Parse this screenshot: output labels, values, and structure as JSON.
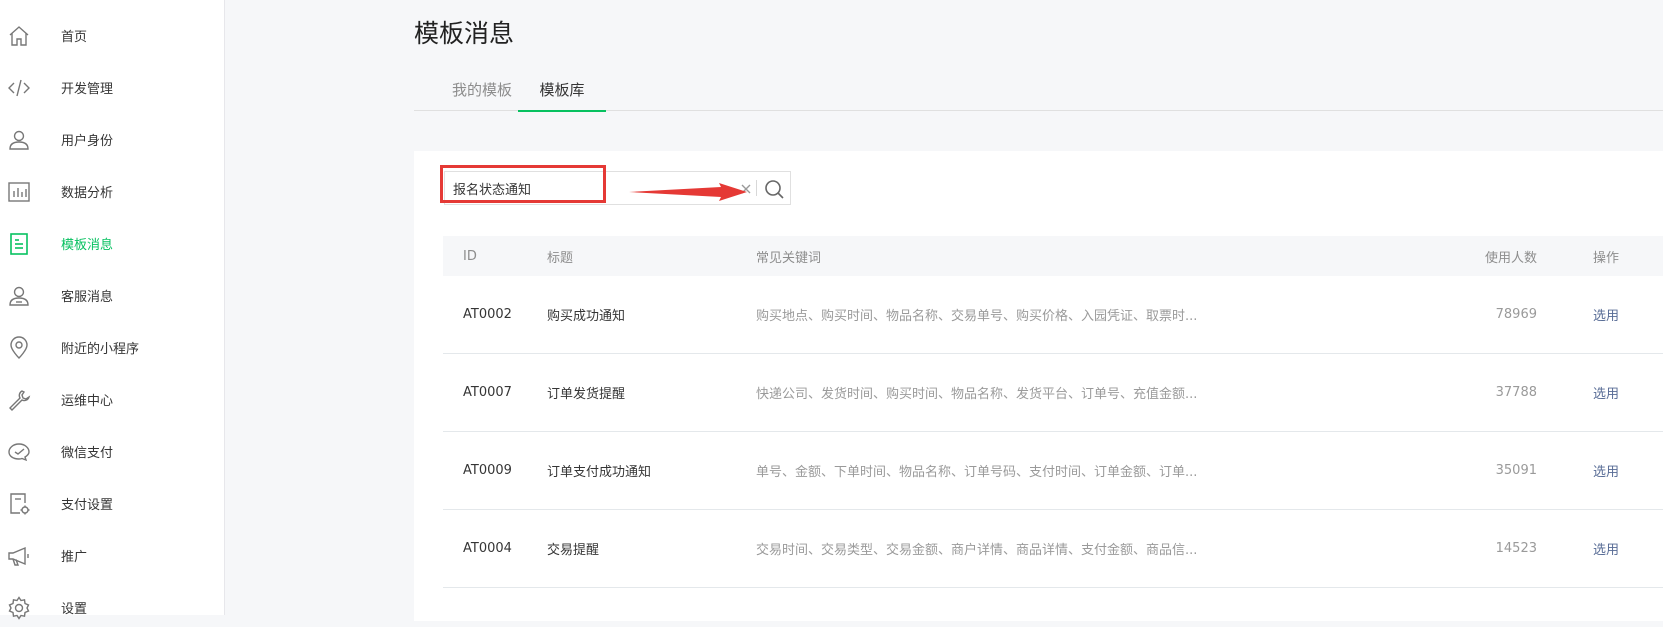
{
  "sidebar": {
    "items": [
      {
        "label": "首页",
        "icon": "home-icon"
      },
      {
        "label": "开发管理",
        "icon": "code-icon"
      },
      {
        "label": "用户身份",
        "icon": "user-icon"
      },
      {
        "label": "数据分析",
        "icon": "bar-chart-icon"
      },
      {
        "label": "模板消息",
        "icon": "document-icon",
        "active": true
      },
      {
        "label": "客服消息",
        "icon": "customer-service-icon"
      },
      {
        "label": "附近的小程序",
        "icon": "location-pin-icon"
      },
      {
        "label": "运维中心",
        "icon": "wrench-icon"
      },
      {
        "label": "微信支付",
        "icon": "wechat-pay-icon"
      },
      {
        "label": "支付设置",
        "icon": "payment-settings-icon"
      },
      {
        "label": "推广",
        "icon": "megaphone-icon"
      },
      {
        "label": "设置",
        "icon": "gear-icon"
      }
    ],
    "active_color": "#07c160"
  },
  "page": {
    "title": "模板消息",
    "tabs": [
      {
        "label": "我的模板",
        "active": false
      },
      {
        "label": "模板库",
        "active": true
      }
    ]
  },
  "search": {
    "value": "报名状态通知",
    "placeholder": ""
  },
  "table": {
    "headers": {
      "id": "ID",
      "title": "标题",
      "keywords": "常见关键词",
      "count": "使用人数",
      "op": "操作"
    },
    "rows": [
      {
        "id": "AT0002",
        "title": "购买成功通知",
        "keywords": "购买地点、购买时间、物品名称、交易单号、购买价格、入园凭证、取票时...",
        "count": "78969",
        "op": "选用"
      },
      {
        "id": "AT0007",
        "title": "订单发货提醒",
        "keywords": "快递公司、发货时间、购买时间、物品名称、发货平台、订单号、充值金额...",
        "count": "37788",
        "op": "选用"
      },
      {
        "id": "AT0009",
        "title": "订单支付成功通知",
        "keywords": "单号、金额、下单时间、物品名称、订单号码、支付时间、订单金额、订单...",
        "count": "35091",
        "op": "选用"
      },
      {
        "id": "AT0004",
        "title": "交易提醒",
        "keywords": "交易时间、交易类型、交易金额、商户详情、商品详情、支付金额、商品信...",
        "count": "14523",
        "op": "选用"
      }
    ]
  },
  "annotation": {
    "color": "#e53935"
  }
}
